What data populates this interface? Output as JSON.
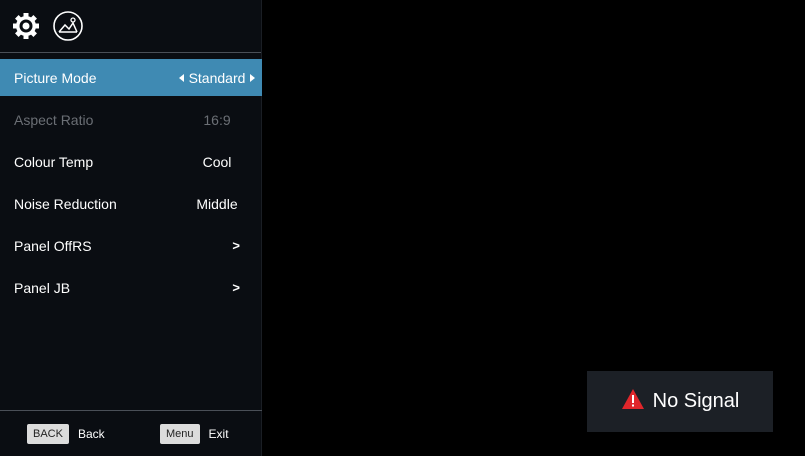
{
  "header": {
    "icons": [
      "gear-icon",
      "picture-icon"
    ]
  },
  "menu": {
    "items": [
      {
        "label": "Picture Mode",
        "value": "Standard",
        "state": "selected",
        "has_arrows": true
      },
      {
        "label": "Aspect Ratio",
        "value": "16:9",
        "state": "disabled"
      },
      {
        "label": "Colour Temp",
        "value": "Cool",
        "state": "normal"
      },
      {
        "label": "Noise Reduction",
        "value": "Middle",
        "state": "normal"
      },
      {
        "label": "Panel OffRS",
        "value": ">",
        "state": "normal"
      },
      {
        "label": "Panel JB",
        "value": ">",
        "state": "normal"
      }
    ]
  },
  "footer": {
    "back_key": "BACK",
    "back_label": "Back",
    "menu_key": "Menu",
    "exit_label": "Exit"
  },
  "status": {
    "text": "No Signal",
    "icon": "warning-icon"
  },
  "colors": {
    "accent": "#3f8ab3",
    "warning": "#e0262b",
    "panel": "#0a0d12",
    "disabled_text": "#6b6f75"
  }
}
